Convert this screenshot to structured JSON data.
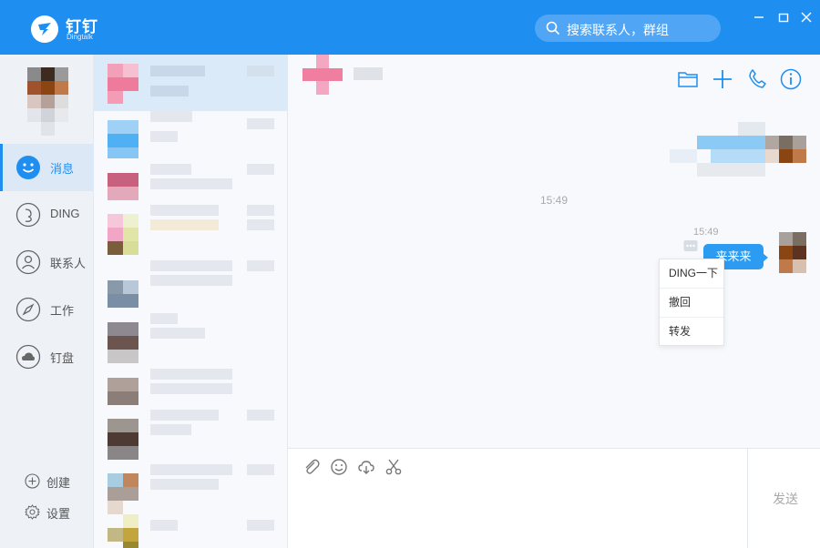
{
  "app": {
    "name": "钉钉",
    "subtitle": "Dingtalk"
  },
  "search": {
    "placeholder": "搜索联系人，群组"
  },
  "nav": {
    "items": [
      {
        "label": "消息",
        "icon": "smile-icon",
        "active": true
      },
      {
        "label": "DING",
        "icon": "ding-icon",
        "active": false
      },
      {
        "label": "联系人",
        "icon": "contacts-icon",
        "active": false
      },
      {
        "label": "工作",
        "icon": "compass-icon",
        "active": false
      },
      {
        "label": "钉盘",
        "icon": "cloud-disk-icon",
        "active": false
      }
    ],
    "bottom": [
      {
        "label": "创建",
        "icon": "plus-circle-icon"
      },
      {
        "label": "设置",
        "icon": "gear-icon"
      }
    ]
  },
  "chat": {
    "timestamps": [
      "15:49",
      "15:49"
    ],
    "message": "来来来",
    "context_menu": [
      "DING一下",
      "撤回",
      "转发"
    ]
  },
  "input": {
    "send_label": "发送",
    "tools": [
      "paperclip-icon",
      "emoji-icon",
      "cloud-upload-icon",
      "scissors-icon"
    ]
  },
  "colors": {
    "accent": "#1f8ef1",
    "bubble": "#2b9cf2",
    "sidebar": "#eef2f7"
  }
}
